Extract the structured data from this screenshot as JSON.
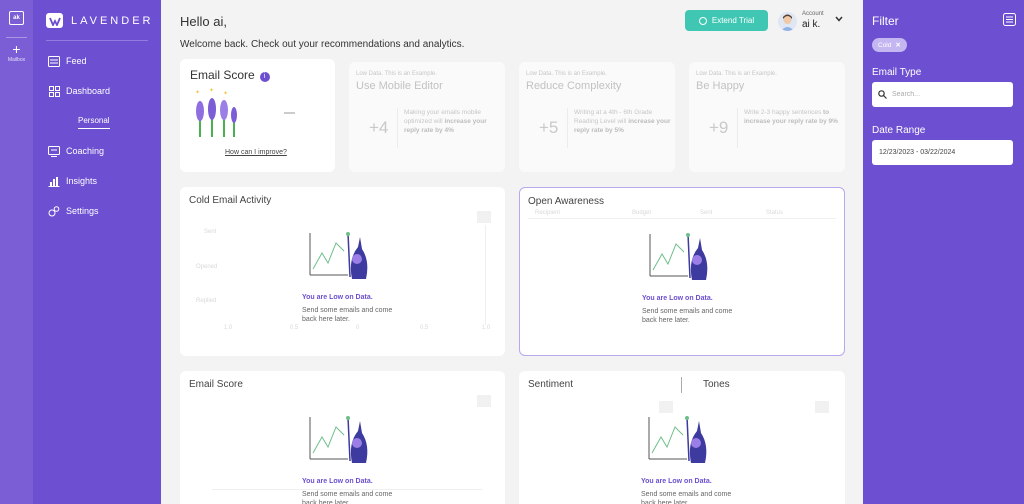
{
  "rail": {
    "badge": "ak",
    "add_label": "Mailbox"
  },
  "sidebar": {
    "logo": "LAVENDER",
    "items": [
      {
        "label": "Feed",
        "icon": "feed-icon"
      },
      {
        "label": "Dashboard",
        "icon": "dashboard-icon"
      },
      {
        "label": "Coaching",
        "icon": "coaching-icon"
      },
      {
        "label": "Insights",
        "icon": "insights-icon"
      },
      {
        "label": "Settings",
        "icon": "settings-icon"
      }
    ],
    "sub_item": "Personal"
  },
  "header": {
    "greeting": "Hello ai,",
    "welcome": "Welcome back. Check out your recommendations and analytics.",
    "extend_trial": "Extend Trial",
    "account_label": "Account",
    "account_name": "ai k."
  },
  "email_score_card": {
    "title": "Email Score",
    "info": "i",
    "link": "How can I improve?"
  },
  "recommendations": [
    {
      "low_data": "Low Data. This is an Example.",
      "title": "Use Mobile Editor",
      "score": "+4",
      "desc_pre": "Making your emails mobile optimized will ",
      "desc_bold": "increase your reply rate by 4%",
      "desc_post": ""
    },
    {
      "low_data": "Low Data. This is an Example.",
      "title": "Reduce Complexity",
      "score": "+5",
      "desc_pre": "Writing at a 4th - 6th Grade Reading Level will ",
      "desc_bold": "increase your reply rate by 5%",
      "desc_post": ""
    },
    {
      "low_data": "Low Data. This is an Example.",
      "title": "Be Happy",
      "score": "+9",
      "desc_pre": "Write 2-3 happy sentences ",
      "desc_bold": "to increase your reply rate by 9%",
      "desc_post": ""
    }
  ],
  "panels": {
    "cold_email": {
      "title": "Cold Email Activity",
      "ghost_y": [
        "Sent",
        "Opened",
        "Replied"
      ],
      "ghost_x": [
        "1.0",
        "0.5",
        "0",
        "0.5",
        "1.0"
      ]
    },
    "open_awareness": {
      "title": "Open Awareness",
      "ghost_cols": [
        "Recipient",
        "Budget",
        "Sent",
        "Status"
      ]
    },
    "email_score": {
      "title": "Email Score"
    },
    "sentiment": {
      "title": "Sentiment",
      "tones_title": "Tones"
    }
  },
  "low_data": {
    "headline": "You are Low on Data.",
    "message": "Send some emails and come back here later."
  },
  "filter": {
    "title": "Filter",
    "chip": "Cold",
    "email_type_label": "Email Type",
    "search_placeholder": "Search...",
    "date_range_label": "Date Range",
    "date_range": "12/23/2023 - 03/22/2024"
  },
  "colors": {
    "brand": "#6d4fd1",
    "teal": "#3fc7b3",
    "panel_border": "#b9a8ee"
  }
}
